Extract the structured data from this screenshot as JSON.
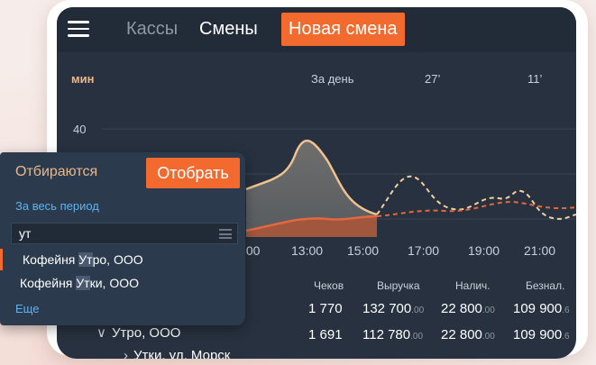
{
  "topbar": {
    "tabs": [
      "Кассы",
      "Смены"
    ],
    "new_shift_label": "Новая смена"
  },
  "chart_header": {
    "unit": "мин",
    "per_day": "За день",
    "temp_1": "27’",
    "temp_2": "11’"
  },
  "chart_data": {
    "type": "area",
    "y_tick_labels": [
      "40"
    ],
    "x_tick_labels": [
      ":00",
      "13:00",
      "15:00",
      "17:00",
      "19:00",
      "21:00"
    ],
    "series": [
      {
        "style": "solid",
        "color": "#f0c28f"
      },
      {
        "style": "solid",
        "color": "#e2683e"
      },
      {
        "style": "dashed",
        "color": "#f3d19f"
      },
      {
        "style": "dashed",
        "color": "#e2683e"
      }
    ]
  },
  "table": {
    "headers": [
      "Чеков",
      "Выручка",
      "Налич.",
      "Безнал."
    ],
    "rows": [
      {
        "label": "",
        "checks": "1 770",
        "revenue": "132 700",
        "revenue_dec": ".00",
        "cash": "22 800",
        "cash_dec": ".00",
        "cashless": "109 900",
        "cashless_dec": ".6"
      },
      {
        "label": "Утро, ООО",
        "checks": "1 691",
        "revenue": "112 780",
        "revenue_dec": ".00",
        "cash": "22 800",
        "cash_dec": ".00",
        "cashless": "109 900",
        "cashless_dec": ".6"
      },
      {
        "label": "Утки, ул. Морск"
      }
    ]
  },
  "popup": {
    "title": "Отбираются",
    "select_label": "Отобрать",
    "period_label": "За весь период",
    "search_value": "ут",
    "items": [
      {
        "before": "Кофейня ",
        "match": "Ут",
        "after": "ро, ООО"
      },
      {
        "before": "Кофейня ",
        "match": "Ут",
        "after": "ки, ООО"
      }
    ],
    "more_label": "Еще"
  }
}
